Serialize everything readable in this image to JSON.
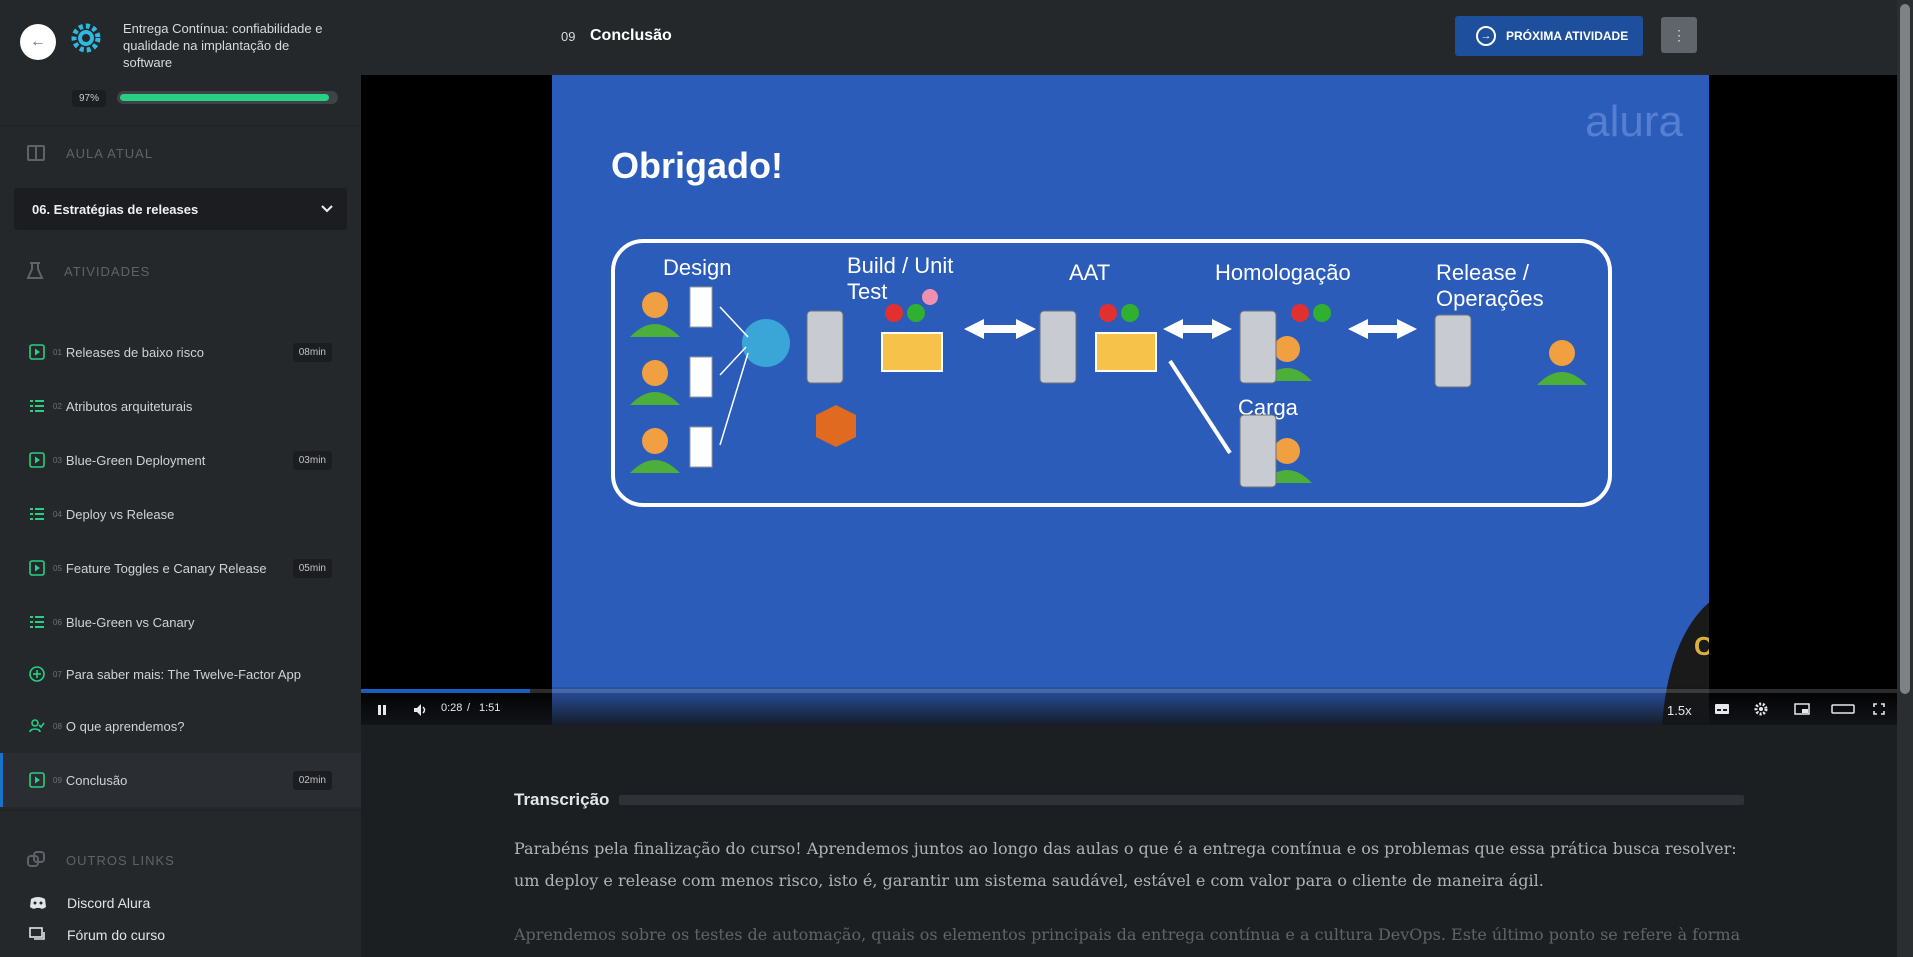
{
  "sidebar": {
    "back_label": "←",
    "course_title": "Entrega Contínua: confiabilidade e qualidade na implantação de software",
    "progress_text": "97%",
    "progress_value": 0.97,
    "collapse_label": "«",
    "current_section_label": "AULA ATUAL",
    "current_lesson": "06. Estratégias de releases",
    "activities_label": "ATIVIDADES",
    "activities": [
      {
        "num": "01",
        "label": "Releases de baixo risco",
        "duration": "08min",
        "icon": "play-icon"
      },
      {
        "num": "02",
        "label": "Atributos arquiteturais",
        "duration": "",
        "icon": "list-icon"
      },
      {
        "num": "03",
        "label": "Blue-Green Deployment",
        "duration": "03min",
        "icon": "play-icon"
      },
      {
        "num": "04",
        "label": "Deploy vs Release",
        "duration": "",
        "icon": "list-icon"
      },
      {
        "num": "05",
        "label": "Feature Toggles e Canary Release",
        "duration": "05min",
        "icon": "play-icon"
      },
      {
        "num": "06",
        "label": "Blue-Green vs Canary",
        "duration": "",
        "icon": "list-icon"
      },
      {
        "num": "07",
        "label": "Para saber mais: The Twelve-Factor App",
        "duration": "",
        "icon": "plus-icon"
      },
      {
        "num": "08",
        "label": "O que aprendemos?",
        "duration": "",
        "icon": "user-check-icon"
      },
      {
        "num": "09",
        "label": "Conclusão",
        "duration": "02min",
        "icon": "play-icon"
      }
    ],
    "other_links_label": "OUTROS LINKS",
    "links": [
      {
        "label": "Discord Alura",
        "icon": "discord-icon"
      },
      {
        "label": "Fórum do curso",
        "icon": "forum-icon"
      }
    ]
  },
  "topbar": {
    "lesson_number": "09",
    "lesson_title": "Conclusão",
    "next_button": "PRÓXIMA ATIVIDADE",
    "menu_label": "⋮"
  },
  "video": {
    "slide_title": "Obrigado!",
    "logo_text": "alura",
    "stages": [
      "Design",
      "Build / Unit Test",
      "AAT",
      "Homologação",
      "Release / Operações",
      "Carga"
    ],
    "presenter_shirt": "Caelum:",
    "current_time": "0:28",
    "time_separator": "/",
    "duration": "1:51",
    "progress": 0.11,
    "speed": "1.5x"
  },
  "transcript": {
    "title": "Transcrição",
    "paragraphs": [
      "Parabéns pela finalização do curso! Aprendemos juntos ao longo das aulas o que é a entrega contínua e os problemas que essa prática busca resolver: um deploy e release com menos risco, isto é, garantir um sistema saudável, estável e com valor para o cliente de maneira ágil.",
      "Aprendemos sobre os testes de automação, quais os elementos principais da entrega contínua e a cultura DevOps. Este último ponto se refere à forma"
    ]
  },
  "colors": {
    "accent": "#1a73c9",
    "progress": "#27d083",
    "next_button": "#1e4f9c",
    "slide_bg": "#2c5cb9"
  }
}
